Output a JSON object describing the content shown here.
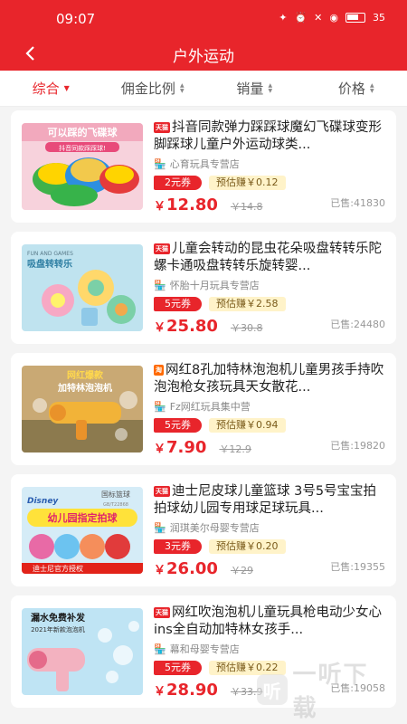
{
  "status": {
    "time": "09:07",
    "battery": "35"
  },
  "nav": {
    "title": "户外运动"
  },
  "sort": [
    {
      "label": "综合",
      "active": true
    },
    {
      "label": "佣金比例"
    },
    {
      "label": "销量"
    },
    {
      "label": "价格"
    }
  ],
  "products": [
    {
      "tag": "天猫",
      "title": "抖音同款弹力踩踩球魔幻飞碟球变形脚踩球儿童户外运动球类...",
      "shop": "心育玩具专营店",
      "coupon": "2元券",
      "earn": "预估赚￥0.12",
      "price": "12.80",
      "orig": "￥14.8",
      "sold": "已售:41830",
      "thumb_top": "可以踩的飞碟球",
      "thumb_sub": "抖音同款踩踩球!"
    },
    {
      "tag": "天猫",
      "title": "儿童会转动的昆虫花朵吸盘转转乐陀螺卡通吸盘转转乐旋转婴...",
      "shop": "怀胎十月玩具专营店",
      "coupon": "5元券",
      "earn": "预估赚￥2.58",
      "price": "25.80",
      "orig": "￥30.8",
      "sold": "已售:24480",
      "thumb_top": "FUN AND GAMES",
      "thumb_sub": "吸盘转转乐"
    },
    {
      "tag": "淘",
      "title": "网红8孔加特林泡泡机儿童男孩手持吹泡泡枪女孩玩具天女散花...",
      "shop": "Fz网红玩具集中营",
      "coupon": "5元券",
      "earn": "预估赚￥0.94",
      "price": "7.90",
      "orig": "￥12.9",
      "sold": "已售:19820",
      "thumb_top": "网红爆款",
      "thumb_sub": "加特林泡泡机"
    },
    {
      "tag": "天猫",
      "title": "迪士尼皮球儿童篮球 3号5号宝宝拍拍球幼儿园专用球足球玩具...",
      "shop": "润琪美尔母婴专营店",
      "coupon": "3元券",
      "earn": "预估赚￥0.20",
      "price": "26.00",
      "orig": "￥29",
      "sold": "已售:19355",
      "thumb_top": "国标篮球",
      "thumb_mid": "GB/T22868",
      "thumb_sub": "幼儿园指定拍球",
      "thumb_foot": "迪士尼官方授权",
      "thumb_logo": "Disney"
    },
    {
      "tag": "天猫",
      "title": "网红吹泡泡机儿童玩具枪电动少女心ins全自动加特林女孩手...",
      "shop": "幕和母婴专营店",
      "coupon": "5元券",
      "earn": "预估赚￥0.22",
      "price": "28.90",
      "orig": "￥33.9",
      "sold": "已售:19058",
      "thumb_top": "漏水免费补发",
      "thumb_sub": "2021年新款泡泡机"
    }
  ],
  "watermark": {
    "text": "一听下载",
    "logo": "听"
  },
  "colors": {
    "brand": "#e8252b",
    "earn_bg": "#fff3c9"
  }
}
